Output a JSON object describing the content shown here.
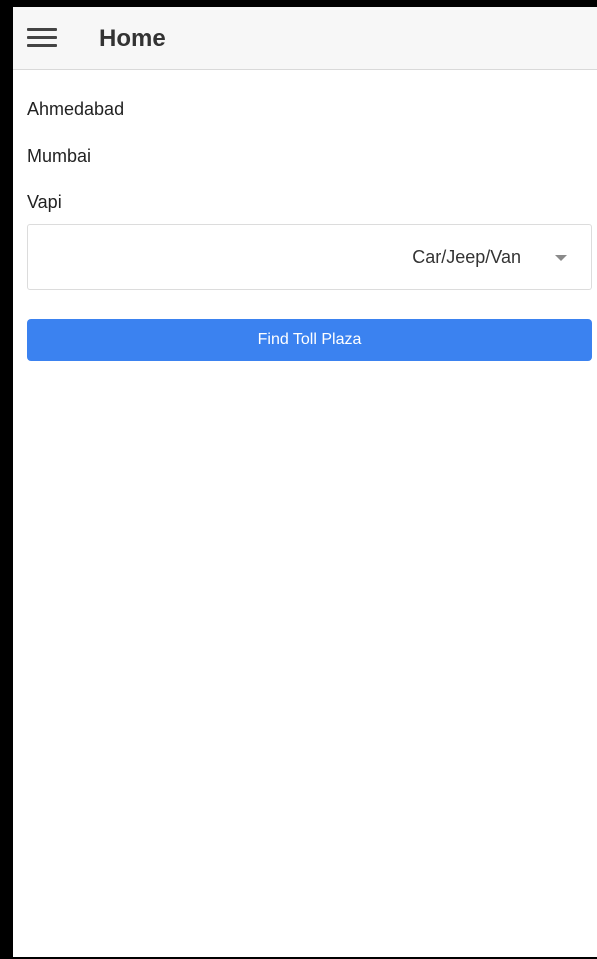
{
  "app_bar": {
    "title": "Home",
    "menu_icon": "hamburger-menu-icon"
  },
  "route": {
    "source": "Ahmedabad",
    "destination": "Mumbai",
    "via": "Vapi"
  },
  "vehicle_select": {
    "selected": "Car/Jeep/Van",
    "caret_icon": "caret-down-icon"
  },
  "actions": {
    "find_label": "Find Toll Plaza"
  },
  "colors": {
    "primary_button": "#3b82f0",
    "app_bar_bg": "#f7f7f7",
    "title_text": "#333333"
  }
}
